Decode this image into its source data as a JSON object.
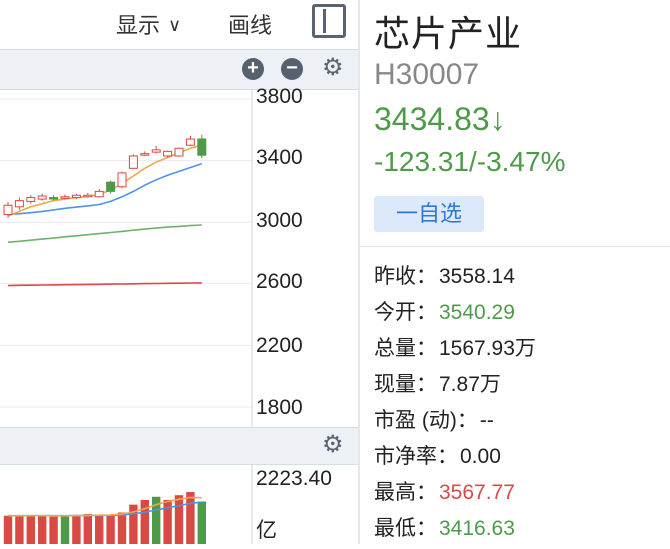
{
  "toolbar": {
    "show_label": "显示",
    "draw_label": "画线"
  },
  "axis": {
    "price_ticks": [
      "3800",
      "3400",
      "3000",
      "2600",
      "2200",
      "1800"
    ],
    "volume_max": "2223.40",
    "volume_unit": "亿"
  },
  "chart_data": {
    "type": "candlestick",
    "y_ticks": [
      3800,
      3400,
      3000,
      2600,
      2200,
      1800
    ],
    "candles": [
      {
        "o": 3050,
        "c": 3110,
        "h": 3130,
        "l": 3030
      },
      {
        "o": 3100,
        "c": 3140,
        "h": 3160,
        "l": 3080
      },
      {
        "o": 3135,
        "c": 3160,
        "h": 3175,
        "l": 3120
      },
      {
        "o": 3150,
        "c": 3170,
        "h": 3185,
        "l": 3140
      },
      {
        "o": 3160,
        "c": 3155,
        "h": 3175,
        "l": 3140
      },
      {
        "o": 3155,
        "c": 3165,
        "h": 3180,
        "l": 3150
      },
      {
        "o": 3160,
        "c": 3175,
        "h": 3185,
        "l": 3150
      },
      {
        "o": 3170,
        "c": 3175,
        "h": 3190,
        "l": 3160
      },
      {
        "o": 3165,
        "c": 3200,
        "h": 3215,
        "l": 3160
      },
      {
        "o": 3260,
        "c": 3200,
        "h": 3270,
        "l": 3185
      },
      {
        "o": 3230,
        "c": 3320,
        "h": 3330,
        "l": 3220
      },
      {
        "o": 3350,
        "c": 3430,
        "h": 3440,
        "l": 3345
      },
      {
        "o": 3440,
        "c": 3445,
        "h": 3460,
        "l": 3430
      },
      {
        "o": 3455,
        "c": 3470,
        "h": 3495,
        "l": 3445
      },
      {
        "o": 3430,
        "c": 3460,
        "h": 3465,
        "l": 3420
      },
      {
        "o": 3430,
        "c": 3480,
        "h": 3485,
        "l": 3425
      },
      {
        "o": 3500,
        "c": 3540,
        "h": 3560,
        "l": 3495
      },
      {
        "o": 3540.29,
        "c": 3434.83,
        "h": 3567.77,
        "l": 3416.63
      }
    ],
    "ma_fast": [
      3040,
      3070,
      3100,
      3120,
      3140,
      3150,
      3160,
      3168,
      3180,
      3210,
      3250,
      3300,
      3350,
      3390,
      3420,
      3450,
      3480,
      3500
    ],
    "ma_mid": [
      3050,
      3055,
      3062,
      3070,
      3080,
      3090,
      3098,
      3106,
      3115,
      3135,
      3165,
      3200,
      3240,
      3275,
      3305,
      3330,
      3355,
      3380
    ],
    "ma_long": [
      2870,
      2876,
      2883,
      2890,
      2897,
      2905,
      2912,
      2919,
      2926,
      2933,
      2940,
      2948,
      2955,
      2962,
      2968,
      2973,
      2978,
      2982
    ],
    "ma_longer": [
      2588,
      2590,
      2591,
      2592,
      2593,
      2594,
      2595,
      2596,
      2597,
      2598,
      2599,
      2600,
      2601,
      2602,
      2603,
      2604,
      2605,
      2606
    ],
    "volume": [
      {
        "v": 900,
        "up": true
      },
      {
        "v": 880,
        "up": true
      },
      {
        "v": 910,
        "up": true
      },
      {
        "v": 890,
        "up": true
      },
      {
        "v": 870,
        "up": true
      },
      {
        "v": 900,
        "up": false
      },
      {
        "v": 920,
        "up": true
      },
      {
        "v": 950,
        "up": true
      },
      {
        "v": 930,
        "up": true
      },
      {
        "v": 910,
        "up": true
      },
      {
        "v": 1000,
        "up": true
      },
      {
        "v": 1250,
        "up": true
      },
      {
        "v": 1400,
        "up": true
      },
      {
        "v": 1500,
        "up": false
      },
      {
        "v": 1400,
        "up": true
      },
      {
        "v": 1550,
        "up": true
      },
      {
        "v": 1650,
        "up": true
      },
      {
        "v": 1350,
        "up": false
      }
    ],
    "vol_ma_fast": [
      900,
      895,
      900,
      900,
      895,
      895,
      900,
      905,
      915,
      920,
      950,
      1020,
      1120,
      1250,
      1350,
      1420,
      1480,
      1470
    ],
    "vol_ma_slow": [
      900,
      900,
      900,
      900,
      900,
      900,
      902,
      905,
      908,
      912,
      925,
      960,
      1010,
      1080,
      1150,
      1220,
      1290,
      1330
    ],
    "volume_max": 2223.4
  },
  "colors": {
    "up": "#d84a43",
    "down": "#4f9a4a",
    "ma_fast": "#f0a64b",
    "ma_mid": "#4f93e8",
    "ma_long": "#6ab36b",
    "ma_longer": "#d84a43"
  },
  "stock": {
    "name": "芯片产业",
    "code": "H30007",
    "price": "3434.83↓",
    "change": "-123.31/-3.47%",
    "watch_button": "一自选"
  },
  "stats": [
    {
      "label": "昨收：",
      "value": "3558.14",
      "color": ""
    },
    {
      "label": "今开：",
      "value": "3540.29",
      "color": "green"
    },
    {
      "label": "总量：",
      "value": "1567.93万",
      "color": ""
    },
    {
      "label": "现量：",
      "value": "7.87万",
      "color": ""
    },
    {
      "label": "市盈 (动)：",
      "value": "--",
      "color": ""
    },
    {
      "label": "市净率：",
      "value": "0.00",
      "color": ""
    },
    {
      "label": "最高：",
      "value": "3567.77",
      "color": "red"
    },
    {
      "label": "最低：",
      "value": "3416.63",
      "color": "green"
    }
  ]
}
